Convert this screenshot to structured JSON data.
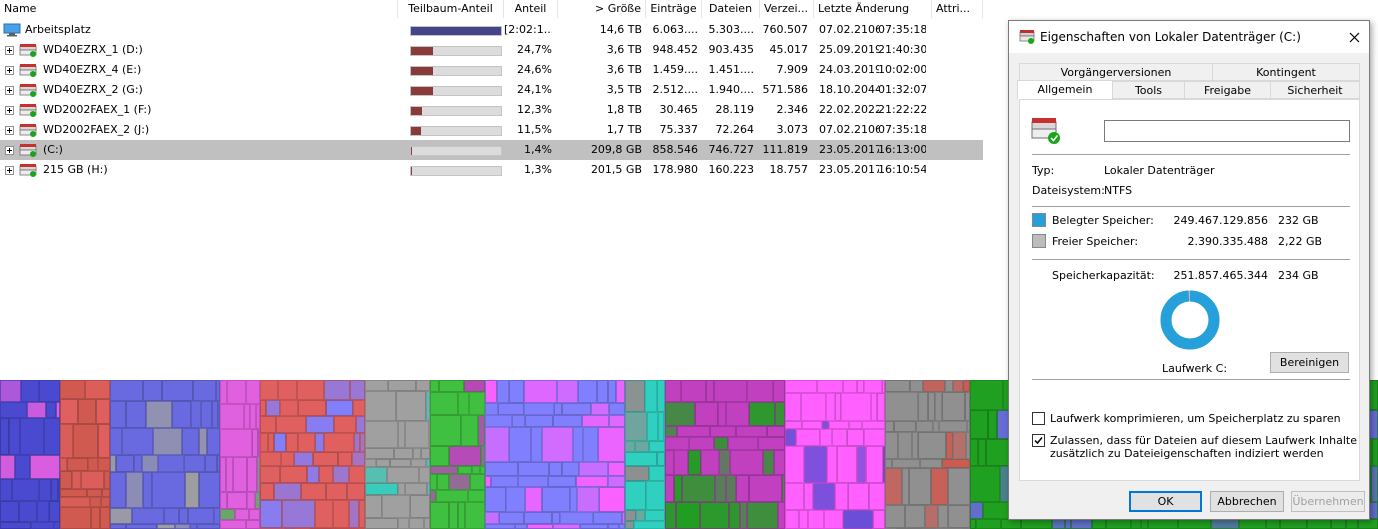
{
  "columns": [
    "Name",
    "Teilbaum-Anteil",
    "Anteil",
    "> Größe",
    "Einträge",
    "Dateien",
    "Verzei...",
    "Letzte Änderung",
    "Attri..."
  ],
  "rows": [
    {
      "name": "Arbeitsplatz",
      "icon": "computer-icon",
      "expand": false,
      "share_value": 1.0,
      "share_color": "#44448c",
      "anteil": "[2:02:1...",
      "groesse": "14,6 TB",
      "eintraege": "6.063....",
      "dateien": "5.303....",
      "verzeichnisse": "760.507",
      "datum": "07.02.2106",
      "zeit": "07:35:18",
      "selected": false
    },
    {
      "name": "WD40EZRX_1 (D:)",
      "icon": "drive-icon",
      "expand": true,
      "share_value": 0.247,
      "share_color": "#8a3a3a",
      "anteil": "24,7%",
      "groesse": "3,6 TB",
      "eintraege": "948.452",
      "dateien": "903.435",
      "verzeichnisse": "45.017",
      "datum": "25.09.2019",
      "zeit": "21:40:30",
      "selected": false
    },
    {
      "name": "WD40EZRX_4 (E:)",
      "icon": "drive-icon",
      "expand": true,
      "share_value": 0.246,
      "share_color": "#8a3a3a",
      "anteil": "24,6%",
      "groesse": "3,6 TB",
      "eintraege": "1.459....",
      "dateien": "1.451....",
      "verzeichnisse": "7.909",
      "datum": "24.03.2019",
      "zeit": "10:02:00",
      "selected": false
    },
    {
      "name": "WD40EZRX_2 (G:)",
      "icon": "drive-icon",
      "expand": true,
      "share_value": 0.241,
      "share_color": "#8a3a3a",
      "anteil": "24,1%",
      "groesse": "3,5 TB",
      "eintraege": "2.512....",
      "dateien": "1.940....",
      "verzeichnisse": "571.586",
      "datum": "18.10.2044",
      "zeit": "01:32:07",
      "selected": false
    },
    {
      "name": "WD2002FAEX_1 (F:)",
      "icon": "drive-icon",
      "expand": true,
      "share_value": 0.123,
      "share_color": "#8a3a3a",
      "anteil": "12,3%",
      "groesse": "1,8 TB",
      "eintraege": "30.465",
      "dateien": "28.119",
      "verzeichnisse": "2.346",
      "datum": "22.02.2022",
      "zeit": "21:22:22",
      "selected": false
    },
    {
      "name": "WD2002FAEX_2 (J:)",
      "icon": "drive-icon",
      "expand": true,
      "share_value": 0.115,
      "share_color": "#8a3a3a",
      "anteil": "11,5%",
      "groesse": "1,7 TB",
      "eintraege": "75.337",
      "dateien": "72.264",
      "verzeichnisse": "3.073",
      "datum": "07.02.2106",
      "zeit": "07:35:18",
      "selected": false
    },
    {
      "name": " (C:)",
      "icon": "system-drive-icon",
      "expand": true,
      "share_value": 0.014,
      "share_color": "#8a3a3a",
      "anteil": "1,4%",
      "groesse": "209,8 GB",
      "eintraege": "858.546",
      "dateien": "746.727",
      "verzeichnisse": "111.819",
      "datum": "23.05.2017",
      "zeit": "16:13:00",
      "selected": true
    },
    {
      "name": "215 GB (H:)",
      "icon": "drive-icon",
      "expand": true,
      "share_value": 0.013,
      "share_color": "#8a3a3a",
      "anteil": "1,3%",
      "groesse": "201,5 GB",
      "eintraege": "178.980",
      "dateien": "160.223",
      "verzeichnisse": "18.757",
      "datum": "23.05.2017",
      "zeit": "16:10:54",
      "selected": false
    }
  ],
  "treemap": {
    "blocks": [
      {
        "color": "#4a4ad0"
      },
      {
        "color": "#d05a50"
      },
      {
        "color": "#6a6ae0"
      },
      {
        "color": "#e060e0"
      },
      {
        "color": "#e06060"
      },
      {
        "color": "#a0a0a0"
      },
      {
        "color": "#40c040"
      },
      {
        "color": "#8080ff"
      },
      {
        "color": "#30d0c0"
      },
      {
        "color": "#c040c0"
      },
      {
        "color": "#ff60ff"
      },
      {
        "color": "#909090"
      },
      {
        "color": "#20a020"
      }
    ]
  },
  "dialog": {
    "title": "Eigenschaften von Lokaler Datenträger (C:)",
    "tabs_top": [
      "Vorgängerversionen",
      "Kontingent"
    ],
    "tabs_bottom": [
      "Allgemein",
      "Tools",
      "Freigabe",
      "Sicherheit"
    ],
    "active_tab": "Allgemein",
    "label_value": "",
    "typ_label": "Typ:",
    "typ_value": "Lokaler Datenträger",
    "fs_label": "Dateisystem:",
    "fs_value": "NTFS",
    "used_label": "Belegter Speicher:",
    "used_bytes": "249.467.129.856",
    "used_gb": "232 GB",
    "used_color": "#26a0da",
    "free_label": "Freier Speicher:",
    "free_bytes": "2.390.335.488",
    "free_gb": "2,22 GB",
    "free_color": "#bcbcbc",
    "cap_label": "Speicherkapazität:",
    "cap_bytes": "251.857.465.344",
    "cap_gb": "234 GB",
    "used_fraction": 0.9905,
    "drive_label": "Laufwerk C:",
    "cleanup_button": "Bereinigen",
    "compress_label": "Laufwerk komprimieren, um Speicherplatz zu sparen",
    "compress_checked": false,
    "index_label_1": "Zulassen, dass für Dateien auf diesem Laufwerk Inhalte",
    "index_label_2": "zusätzlich zu Dateieigenschaften indiziert werden",
    "index_checked": true,
    "ok_button": "OK",
    "cancel_button": "Abbrechen",
    "apply_button": "Übernehmen"
  }
}
